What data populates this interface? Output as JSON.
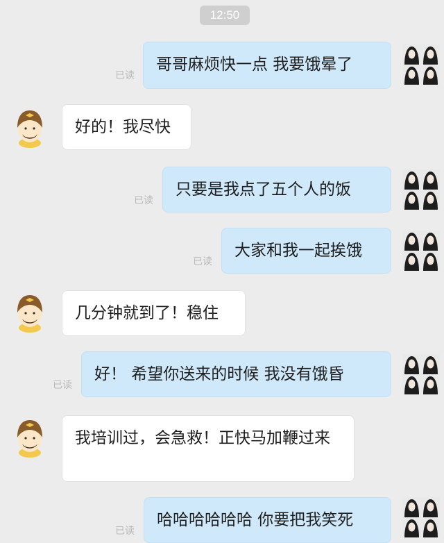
{
  "header": {
    "time": "12:50"
  },
  "messages": [
    {
      "side": "sent",
      "text": "哥哥麻烦快一点 我要饿晕了",
      "read_label": "已读"
    },
    {
      "side": "received",
      "text": "好的！我尽快"
    },
    {
      "side": "sent",
      "text": "只要是我点了五个人的饭",
      "read_label": "已读"
    },
    {
      "side": "sent",
      "text": "大家和我一起挨饿",
      "read_label": "已读"
    },
    {
      "side": "received",
      "text": "几分钟就到了！稳住"
    },
    {
      "side": "sent",
      "text": "好！ 希望你送来的时候 我没有饿昏",
      "read_label": "已读"
    },
    {
      "side": "received",
      "text": "我培训过，会急救！正快马加鞭过来"
    },
    {
      "side": "sent",
      "text": "哈哈哈哈哈哈 你要把我笑死",
      "read_label": "已读"
    }
  ],
  "icons": {
    "sender_avatar": "group-avatar-icon",
    "courier_avatar": "courier-avatar-icon"
  },
  "colors": {
    "background": "#ececec",
    "sent_bubble": "#cfe9fb",
    "received_bubble": "#ffffff",
    "courier_face": "#fbe7c7",
    "courier_helmet": "#8a5b2a"
  }
}
